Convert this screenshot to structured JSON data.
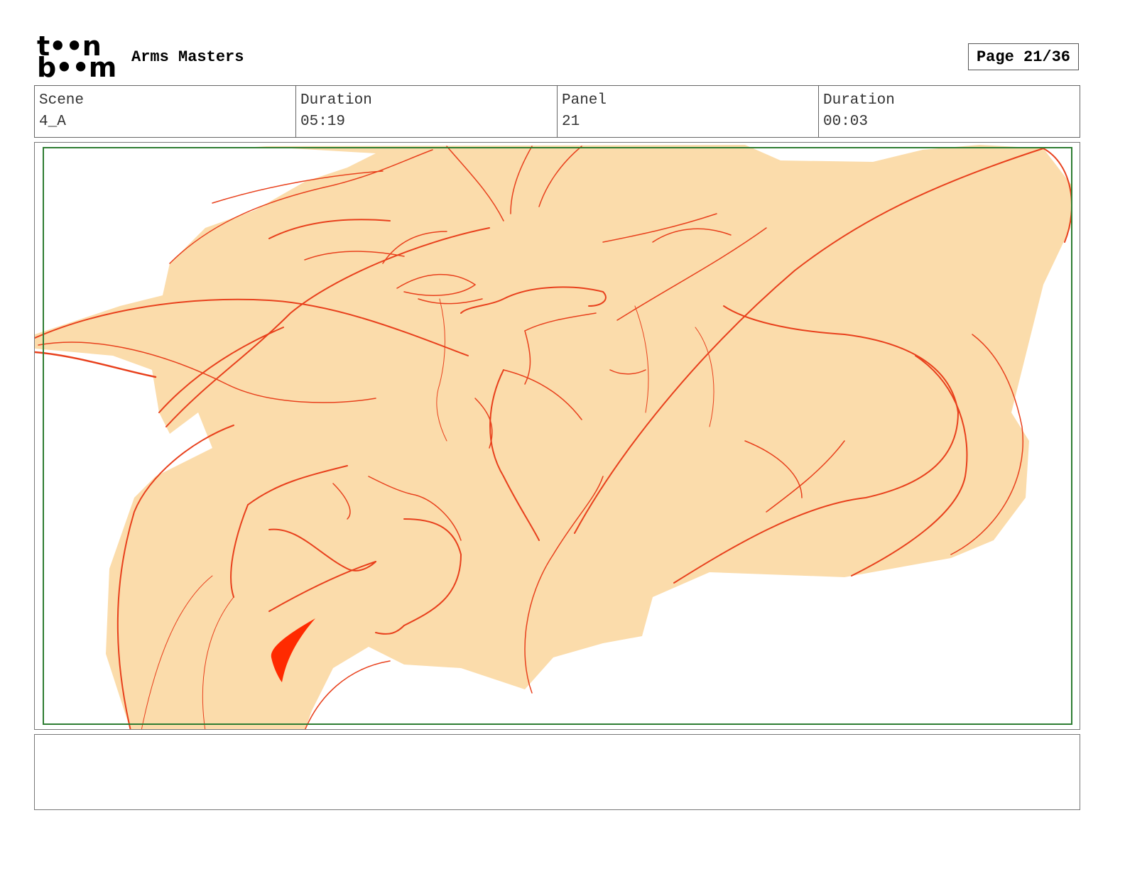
{
  "header": {
    "logo_line1": "t••n",
    "logo_line2": "b••m",
    "project_title": "Arms Masters",
    "page_label": "Page 21/36"
  },
  "info": {
    "scene_label": "Scene",
    "scene_value": "4_A",
    "scene_duration_label": "Duration",
    "scene_duration_value": "05:19",
    "panel_label": "Panel",
    "panel_value": "21",
    "panel_duration_label": "Duration",
    "panel_duration_value": "00:03"
  },
  "panel": {
    "image": "storyboard-sketch-creature-face",
    "fill_color": "#fbdcab",
    "line_color": "#e8401c",
    "safe_frame_color": "#2e7d32"
  },
  "notes": {
    "text": ""
  }
}
